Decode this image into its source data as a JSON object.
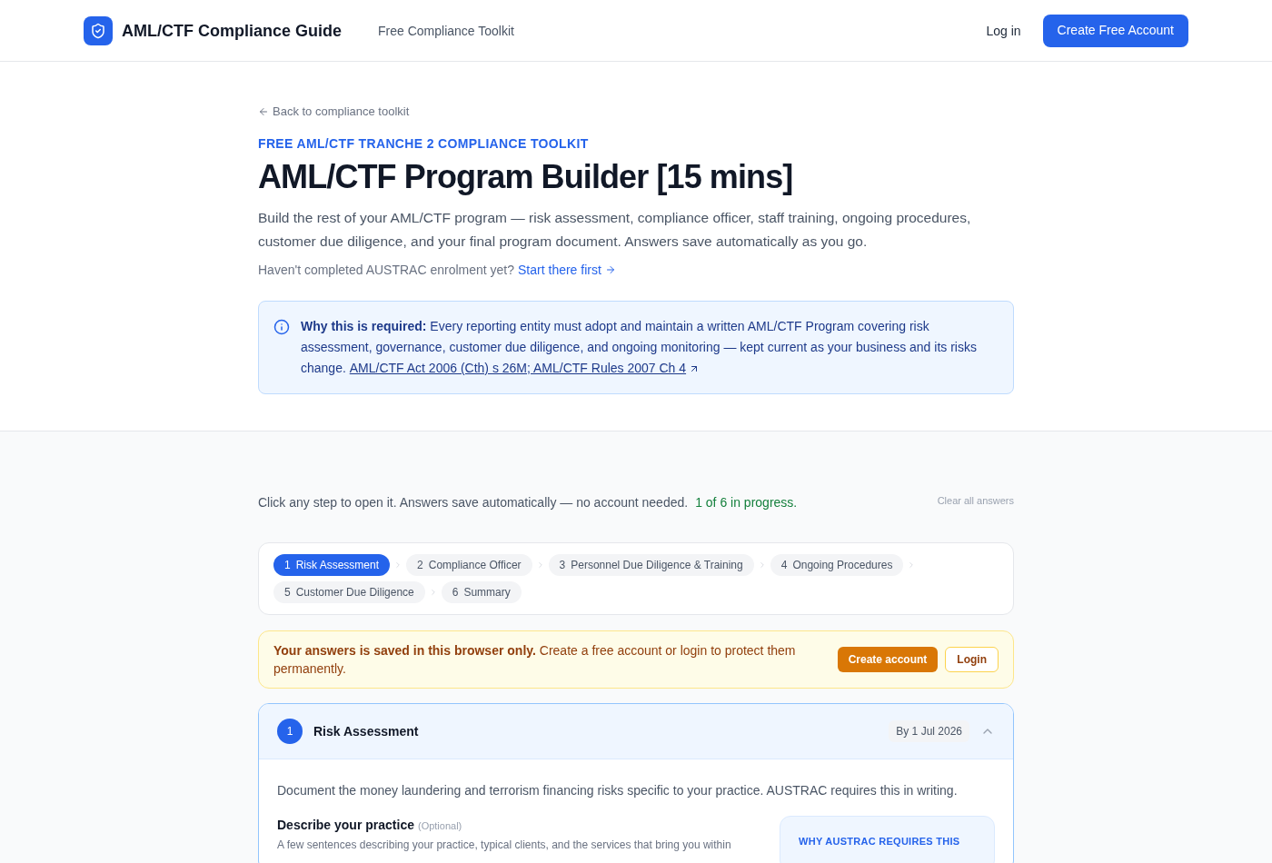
{
  "header": {
    "logo_title": "AML/CTF Compliance Guide",
    "nav_link": "Free Compliance Toolkit",
    "login": "Log in",
    "cta": "Create Free Account"
  },
  "intro": {
    "back_link": "Back to compliance toolkit",
    "eyebrow": "FREE AML/CTF TRANCHE 2 COMPLIANCE TOOLKIT",
    "title": "AML/CTF Program Builder [15 mins]",
    "description": "Build the rest of your AML/CTF program — risk assessment, compliance officer, staff training, ongoing procedures, customer due diligence, and your final program document. Answers save automatically as you go.",
    "enrolment_prompt": "Haven't completed AUSTRAC enrolment yet?",
    "enrolment_link": "Start there first"
  },
  "notice": {
    "text": "**Why this is required:** Every reporting entity must adopt and maintain a written AML/CTF Program covering risk assessment, governance, customer due diligence, and ongoing monitoring — kept current as your business and its risks change.",
    "citation_link": "AML/CTF Act 2006 (Cth) s 26M; AML/CTF Rules 2007 Ch 4"
  },
  "progress": {
    "instructions": "Click any step to open it. Answers save automatically — no account needed.",
    "status": "1 of 6 in progress.",
    "clear_link": "Clear all answers"
  },
  "steps": [
    {
      "number": "1",
      "label": "Risk Assessment",
      "selected": true
    },
    {
      "number": "2",
      "label": "Compliance Officer",
      "selected": false
    },
    {
      "number": "3",
      "label": "Personnel Due Diligence & Training",
      "selected": false
    },
    {
      "number": "4",
      "label": "Ongoing Procedures",
      "selected": false
    },
    {
      "number": "5",
      "label": "Customer Due Diligence",
      "selected": false
    },
    {
      "number": "6",
      "label": "Summary",
      "selected": false
    }
  ],
  "save_warning": {
    "text": "**Your answers is saved in this browser only.** Create a free account or login to protect them permanently.",
    "buttons": [
      {
        "label": "Create account",
        "kind": "primary"
      },
      {
        "label": "Login",
        "kind": "secondary"
      }
    ]
  },
  "section": {
    "number": "1",
    "title": "Risk Assessment",
    "due": "By 1 Jul 2026",
    "expanded": true,
    "description": "Document the money laundering and terrorism financing risks specific to your practice. AUSTRAC requires this in writing.",
    "field": {
      "label": "Describe your practice",
      "optional": "(Optional)",
      "hint": "A few sentences describing your practice, typical clients, and the services that bring you within"
    },
    "aside": {
      "title": "WHY AUSTRAC REQUIRES THIS"
    }
  }
}
